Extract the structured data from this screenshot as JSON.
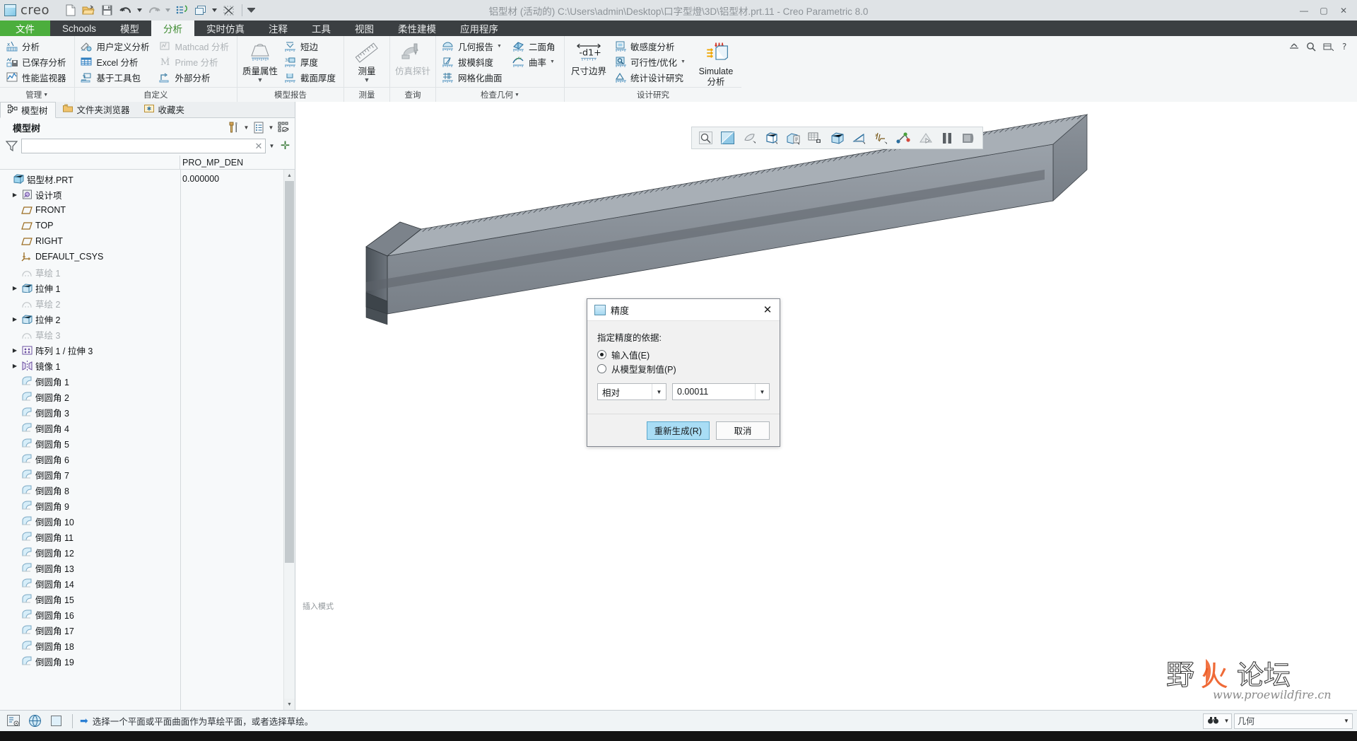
{
  "window": {
    "title": "铝型材 (活动的) C:\\Users\\admin\\Desktop\\口字型燈\\3D\\铝型材.prt.11 - Creo Parametric 8.0",
    "brand": "creo",
    "minimize": "—",
    "maximize": "▢",
    "close": "✕"
  },
  "quick_access": [
    {
      "name": "new-file-icon",
      "tip": "新建"
    },
    {
      "name": "open-file-icon",
      "tip": "打开"
    },
    {
      "name": "save-icon",
      "tip": "保存"
    },
    {
      "name": "undo-icon",
      "tip": "撤消"
    },
    {
      "name": "redo-icon",
      "tip": "重做"
    },
    {
      "name": "regenerate-icon",
      "tip": "重新生成"
    },
    {
      "name": "window-switch-icon",
      "tip": "窗口"
    },
    {
      "name": "close-window-icon",
      "tip": "关闭"
    }
  ],
  "tabs": [
    {
      "label": "文件",
      "kind": "file"
    },
    {
      "label": "Schools",
      "kind": "normal"
    },
    {
      "label": "模型",
      "kind": "normal"
    },
    {
      "label": "分析",
      "kind": "active"
    },
    {
      "label": "实时仿真",
      "kind": "normal"
    },
    {
      "label": "注释",
      "kind": "normal"
    },
    {
      "label": "工具",
      "kind": "normal"
    },
    {
      "label": "视图",
      "kind": "normal"
    },
    {
      "label": "柔性建模",
      "kind": "normal"
    },
    {
      "label": "应用程序",
      "kind": "normal"
    }
  ],
  "ribbon": {
    "groups": [
      {
        "label": "管理",
        "has_caret": true,
        "items": [
          {
            "label": "分析",
            "icon": "analysis-icon",
            "disabled": false
          },
          {
            "label": "已保存分析",
            "icon": "saved-analysis-icon",
            "disabled": false
          },
          {
            "label": "性能监视器",
            "icon": "performance-monitor-icon",
            "disabled": false
          }
        ]
      },
      {
        "label": "自定义",
        "has_caret": false,
        "items": [
          {
            "label": "用户定义分析",
            "icon": "user-defined-analysis-icon",
            "disabled": false
          },
          {
            "label": "Excel 分析",
            "icon": "excel-analysis-icon",
            "disabled": false
          },
          {
            "label": "基于工具包",
            "icon": "toolkit-analysis-icon",
            "disabled": false
          },
          {
            "label": "Mathcad 分析",
            "icon": "mathcad-analysis-icon",
            "disabled": true
          },
          {
            "label": "Prime 分析",
            "icon": "prime-analysis-icon",
            "disabled": true
          },
          {
            "label": "外部分析",
            "icon": "external-analysis-icon",
            "disabled": false
          }
        ]
      },
      {
        "label": "模型报告",
        "has_caret": false,
        "big": {
          "label": "质量属性",
          "icon": "mass-properties-icon",
          "caret": "▼"
        },
        "items": [
          {
            "label": "短边",
            "icon": "short-edge-icon",
            "disabled": false
          },
          {
            "label": "厚度",
            "icon": "thickness-icon",
            "disabled": false
          },
          {
            "label": "截面厚度",
            "icon": "section-thickness-icon",
            "disabled": false
          }
        ]
      },
      {
        "label": "测量",
        "has_caret": false,
        "big": {
          "label": "测量",
          "icon": "measure-icon",
          "caret": "▼"
        },
        "items": []
      },
      {
        "label": "查询",
        "has_caret": false,
        "big": {
          "label": "仿真探针",
          "icon": "simulation-probe-icon",
          "caret": "",
          "disabled": true
        },
        "items": []
      },
      {
        "label": "检查几何",
        "has_caret": true,
        "items": [
          {
            "label": "几何报告",
            "icon": "geometry-report-icon",
            "disabled": false,
            "caret": "▼"
          },
          {
            "label": "拔模斜度",
            "icon": "draft-angle-icon",
            "disabled": false
          },
          {
            "label": "网格化曲面",
            "icon": "mesh-surface-icon",
            "disabled": false
          },
          {
            "label": "二面角",
            "icon": "dihedral-angle-icon",
            "disabled": false
          },
          {
            "label": "曲率",
            "icon": "curvature-icon",
            "disabled": false,
            "caret": "▼"
          }
        ]
      },
      {
        "label": "设计研究",
        "has_caret": false,
        "big": {
          "label": "尺寸边界",
          "icon": "dimension-bound-icon",
          "caret": ""
        },
        "items": [
          {
            "label": "敏感度分析",
            "icon": "sensitivity-analysis-icon",
            "disabled": false
          },
          {
            "label": "可行性/优化",
            "icon": "feasibility-optimization-icon",
            "disabled": false,
            "caret": "▼"
          },
          {
            "label": "统计设计研究",
            "icon": "statistical-design-study-icon",
            "disabled": false
          }
        ],
        "big2": {
          "label1": "Simulate",
          "label2": "分析",
          "icon": "simulate-analysis-icon"
        }
      }
    ],
    "right_buttons": [
      {
        "name": "collapse-ribbon-icon"
      },
      {
        "name": "search-icon"
      },
      {
        "name": "ribbon-options-icon"
      },
      {
        "name": "help-icon"
      }
    ]
  },
  "left_panel": {
    "nav_tabs": [
      {
        "label": "模型树",
        "icon": "model-tree-icon",
        "active": true
      },
      {
        "label": "文件夹浏览器",
        "icon": "folder-browser-icon",
        "active": false
      },
      {
        "label": "收藏夹",
        "icon": "favorites-icon",
        "active": false
      }
    ],
    "header_title": "模型树",
    "header_tools": [
      {
        "name": "settings-tools-icon",
        "caret": "▼"
      },
      {
        "name": "display-list-icon",
        "caret": "▼"
      },
      {
        "name": "tree-filter-icon",
        "caret": ""
      }
    ],
    "filter": {
      "value": "",
      "placeholder": "",
      "clear": "✕",
      "caret": "▼",
      "plus": "✛"
    },
    "column_header": "PRO_MP_DEN",
    "root_value": "0.000000",
    "tree": [
      {
        "label": "铝型材.PRT",
        "icon": "part-icon",
        "indent": 0,
        "expand": "",
        "dim": false,
        "value": "0.000000"
      },
      {
        "label": "设计项",
        "icon": "design-items-icon",
        "indent": 1,
        "expand": "▶",
        "dim": false
      },
      {
        "label": "FRONT",
        "icon": "datum-plane-icon",
        "indent": 1,
        "expand": "",
        "dim": false
      },
      {
        "label": "TOP",
        "icon": "datum-plane-icon",
        "indent": 1,
        "expand": "",
        "dim": false
      },
      {
        "label": "RIGHT",
        "icon": "datum-plane-icon",
        "indent": 1,
        "expand": "",
        "dim": false
      },
      {
        "label": "DEFAULT_CSYS",
        "icon": "csys-icon",
        "indent": 1,
        "expand": "",
        "dim": false
      },
      {
        "label": "草绘 1",
        "icon": "sketch-icon",
        "indent": 1,
        "expand": "",
        "dim": true
      },
      {
        "label": "拉伸 1",
        "icon": "extrude-icon",
        "indent": 1,
        "expand": "▶",
        "dim": false
      },
      {
        "label": "草绘 2",
        "icon": "sketch-icon",
        "indent": 1,
        "expand": "",
        "dim": true
      },
      {
        "label": "拉伸 2",
        "icon": "extrude-icon",
        "indent": 1,
        "expand": "▶",
        "dim": false
      },
      {
        "label": "草绘 3",
        "icon": "sketch-icon",
        "indent": 1,
        "expand": "",
        "dim": true
      },
      {
        "label": "阵列 1 / 拉伸 3",
        "icon": "pattern-icon",
        "indent": 1,
        "expand": "▶",
        "dim": false
      },
      {
        "label": "镜像 1",
        "icon": "mirror-icon",
        "indent": 1,
        "expand": "▶",
        "dim": false
      },
      {
        "label": "倒圆角 1",
        "icon": "round-icon",
        "indent": 1,
        "expand": "",
        "dim": false
      },
      {
        "label": "倒圆角 2",
        "icon": "round-icon",
        "indent": 1,
        "expand": "",
        "dim": false
      },
      {
        "label": "倒圆角 3",
        "icon": "round-icon",
        "indent": 1,
        "expand": "",
        "dim": false
      },
      {
        "label": "倒圆角 4",
        "icon": "round-icon",
        "indent": 1,
        "expand": "",
        "dim": false
      },
      {
        "label": "倒圆角 5",
        "icon": "round-icon",
        "indent": 1,
        "expand": "",
        "dim": false
      },
      {
        "label": "倒圆角 6",
        "icon": "round-icon",
        "indent": 1,
        "expand": "",
        "dim": false
      },
      {
        "label": "倒圆角 7",
        "icon": "round-icon",
        "indent": 1,
        "expand": "",
        "dim": false
      },
      {
        "label": "倒圆角 8",
        "icon": "round-icon",
        "indent": 1,
        "expand": "",
        "dim": false
      },
      {
        "label": "倒圆角 9",
        "icon": "round-icon",
        "indent": 1,
        "expand": "",
        "dim": false
      },
      {
        "label": "倒圆角 10",
        "icon": "round-icon",
        "indent": 1,
        "expand": "",
        "dim": false
      },
      {
        "label": "倒圆角 11",
        "icon": "round-icon",
        "indent": 1,
        "expand": "",
        "dim": false
      },
      {
        "label": "倒圆角 12",
        "icon": "round-icon",
        "indent": 1,
        "expand": "",
        "dim": false
      },
      {
        "label": "倒圆角 13",
        "icon": "round-icon",
        "indent": 1,
        "expand": "",
        "dim": false
      },
      {
        "label": "倒圆角 14",
        "icon": "round-icon",
        "indent": 1,
        "expand": "",
        "dim": false
      },
      {
        "label": "倒圆角 15",
        "icon": "round-icon",
        "indent": 1,
        "expand": "",
        "dim": false
      },
      {
        "label": "倒圆角 16",
        "icon": "round-icon",
        "indent": 1,
        "expand": "",
        "dim": false
      },
      {
        "label": "倒圆角 17",
        "icon": "round-icon",
        "indent": 1,
        "expand": "",
        "dim": false
      },
      {
        "label": "倒圆角 18",
        "icon": "round-icon",
        "indent": 1,
        "expand": "",
        "dim": false
      },
      {
        "label": "倒圆角 19",
        "icon": "round-icon",
        "indent": 1,
        "expand": "",
        "dim": false
      }
    ]
  },
  "viewport": {
    "graphics_toolbar": [
      {
        "name": "zoom-to-fit-icon"
      },
      {
        "name": "repaint-icon"
      },
      {
        "name": "datum-display-icon"
      },
      {
        "name": "display-style-icon"
      },
      {
        "name": "saved-orientations-icon"
      },
      {
        "name": "view-manager-icon"
      },
      {
        "name": "perspective-view-icon"
      },
      {
        "name": "appearance-icon"
      },
      {
        "name": "annotation-display-icon"
      },
      {
        "name": "spin-center-icon"
      },
      {
        "name": "play-simulation-icon"
      },
      {
        "name": "pause-icon"
      },
      {
        "name": "stop-icon"
      }
    ],
    "insert_mode_label": "插入模式",
    "watermark_main": "野火论坛",
    "watermark_sub": "www.proewildfire.cn"
  },
  "dialog": {
    "title": "精度",
    "close": "✕",
    "prompt": "指定精度的依据:",
    "options": [
      {
        "label": "输入值(E)",
        "selected": true
      },
      {
        "label": "从模型复制值(P)",
        "selected": false
      }
    ],
    "type_select": {
      "value": "相对",
      "caret": "▼"
    },
    "value_field": {
      "value": "0.00011",
      "caret": "▼"
    },
    "buttons": [
      {
        "label": "重新生成(R)",
        "primary": true
      },
      {
        "label": "取消",
        "primary": false
      }
    ]
  },
  "statusbar": {
    "left_icons": [
      {
        "name": "selection-filter-icon"
      },
      {
        "name": "web-browser-icon"
      },
      {
        "name": "panel-toggle-icon"
      }
    ],
    "message": "选择一个平面或平面曲面作为草绘平面，或者选择草绘。",
    "message_arrow": "➡",
    "find_icon": "find-icon",
    "find_caret": "▼",
    "filter_combo": {
      "value": "几何",
      "caret": "▼"
    }
  },
  "colors": {
    "accent_green": "#4cae3d",
    "tab_dark": "#3b3f42",
    "ribbon_bg": "#f4f6f7",
    "dialog_primary": "#a9ddf5",
    "watermark_orange": "#ee5a22"
  }
}
